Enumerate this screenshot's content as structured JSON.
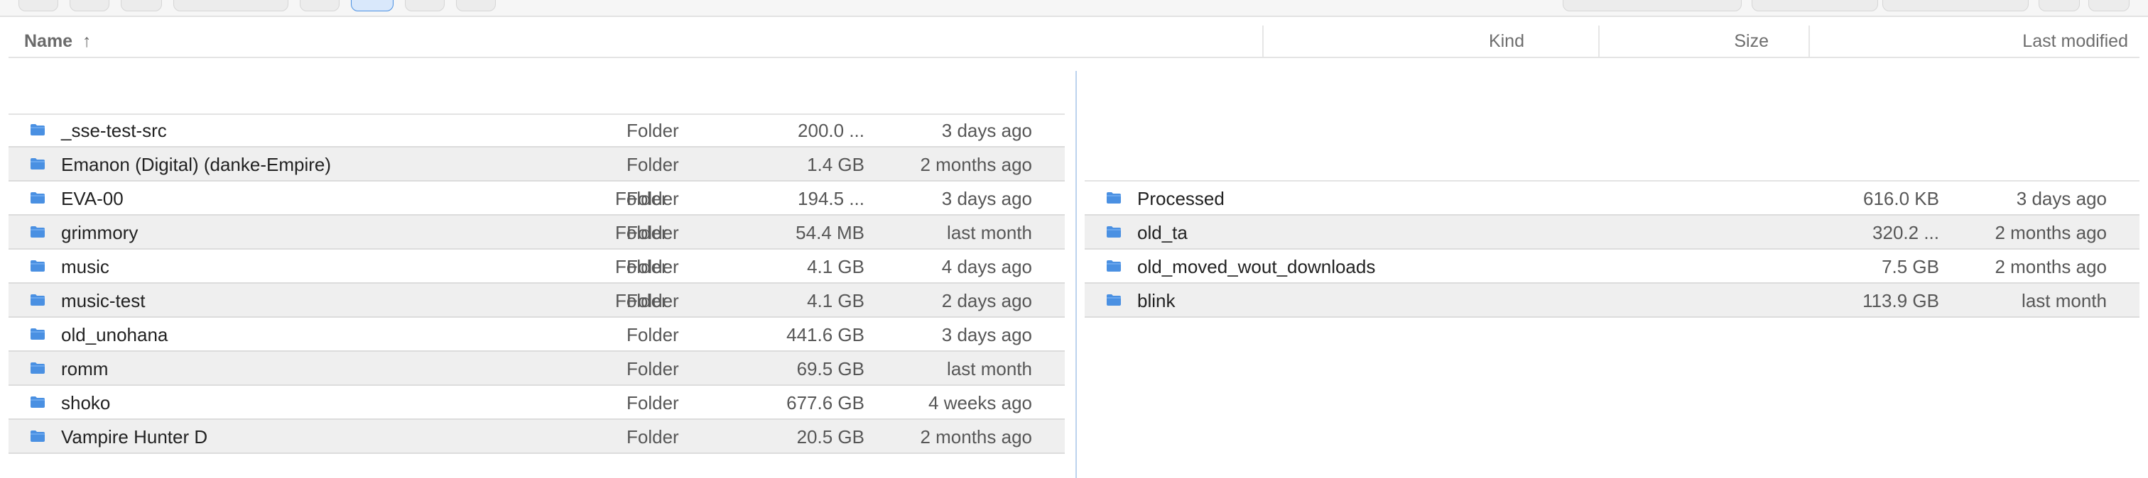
{
  "columns": {
    "name": "Name",
    "sort_arrow": "↑",
    "kind": "Kind",
    "size": "Size",
    "last_modified": "Last modified"
  },
  "left_pane": {
    "rows": [
      {
        "name": "_sse-test-src",
        "kind": "Folder",
        "size": "200.0 ...",
        "modified": "3 days ago"
      },
      {
        "name": "Emanon (Digital) (danke-Empire)",
        "kind": "Folder",
        "size": "1.4 GB",
        "modified": "2 months ago"
      },
      {
        "name": "EVA-00",
        "kind": "Folder",
        "size": "194.5 ...",
        "modified": "3 days ago"
      },
      {
        "name": "grimmory",
        "kind": "Folder",
        "size": "54.4 MB",
        "modified": "last month"
      },
      {
        "name": "music",
        "kind": "Folder",
        "size": "4.1 GB",
        "modified": "4 days ago"
      },
      {
        "name": "music-test",
        "kind": "Folder",
        "size": "4.1 GB",
        "modified": "2 days ago"
      },
      {
        "name": "old_unohana",
        "kind": "Folder",
        "size": "441.6 GB",
        "modified": "3 days ago"
      },
      {
        "name": "romm",
        "kind": "Folder",
        "size": "69.5 GB",
        "modified": "last month"
      },
      {
        "name": "shoko",
        "kind": "Folder",
        "size": "677.6 GB",
        "modified": "4 weeks ago"
      },
      {
        "name": "Vampire Hunter D",
        "kind": "Folder",
        "size": "20.5 GB",
        "modified": "2 months ago"
      }
    ]
  },
  "right_pane": {
    "rows": [
      {
        "name": "Processed",
        "kind": "Folder",
        "size": "616.0 KB",
        "modified": "3 days ago"
      },
      {
        "name": "old_ta",
        "kind": "Folder",
        "size": "320.2 ...",
        "modified": "2 months ago"
      },
      {
        "name": "old_moved_wout_downloads",
        "kind": "Folder",
        "size": "7.5 GB",
        "modified": "2 months ago"
      },
      {
        "name": "blink",
        "kind": "Folder",
        "size": "113.9 GB",
        "modified": "last month"
      }
    ]
  },
  "colors": {
    "folder_icon": "#4a90e2",
    "alt_row": "#efefef",
    "splitter": "#bcd2ee"
  },
  "icons": {
    "folder": "folder-icon"
  }
}
